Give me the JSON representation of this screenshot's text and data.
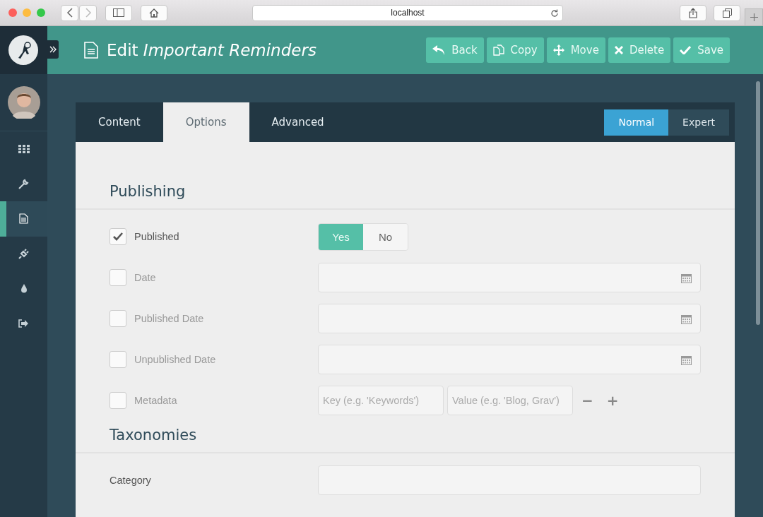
{
  "browser": {
    "url": "localhost"
  },
  "header": {
    "title_prefix": "Edit",
    "title_page": "Important Reminders",
    "actions": [
      {
        "label": "Back",
        "kind": "back"
      },
      {
        "label": "Copy",
        "kind": "copy"
      },
      {
        "label": "Move",
        "kind": "move"
      },
      {
        "label": "Delete",
        "kind": "delete"
      },
      {
        "label": "Save",
        "kind": "save"
      }
    ]
  },
  "sidebar": {
    "items": [
      {
        "kind": "dashboard",
        "selected": false
      },
      {
        "kind": "configuration",
        "selected": false
      },
      {
        "kind": "pages",
        "selected": true
      },
      {
        "kind": "plugins",
        "selected": false
      },
      {
        "kind": "themes",
        "selected": false
      },
      {
        "kind": "logout",
        "selected": false
      }
    ]
  },
  "tabs": [
    {
      "label": "Content",
      "selected": false
    },
    {
      "label": "Options",
      "selected": true
    },
    {
      "label": "Advanced",
      "selected": false
    }
  ],
  "modes": [
    {
      "label": "Normal",
      "selected": true
    },
    {
      "label": "Expert",
      "selected": false
    }
  ],
  "sections": [
    {
      "title": "Publishing",
      "rows": [
        {
          "kind": "toggle",
          "label": "Published",
          "checked": true,
          "options": [
            {
              "label": "Yes",
              "selected": true
            },
            {
              "label": "No",
              "selected": false
            }
          ]
        },
        {
          "kind": "date",
          "label": "Date",
          "checked": false
        },
        {
          "kind": "date",
          "label": "Published Date",
          "checked": false
        },
        {
          "kind": "date",
          "label": "Unpublished Date",
          "checked": false
        },
        {
          "kind": "metadata",
          "label": "Metadata",
          "checked": false,
          "key_placeholder": "Key (e.g. 'Keywords')",
          "value_placeholder": "Value (e.g. 'Blog, Grav')",
          "remove": "−",
          "add": "+"
        }
      ]
    },
    {
      "title": "Taxonomies",
      "rows": [
        {
          "kind": "text",
          "label": "Category"
        }
      ]
    }
  ]
}
